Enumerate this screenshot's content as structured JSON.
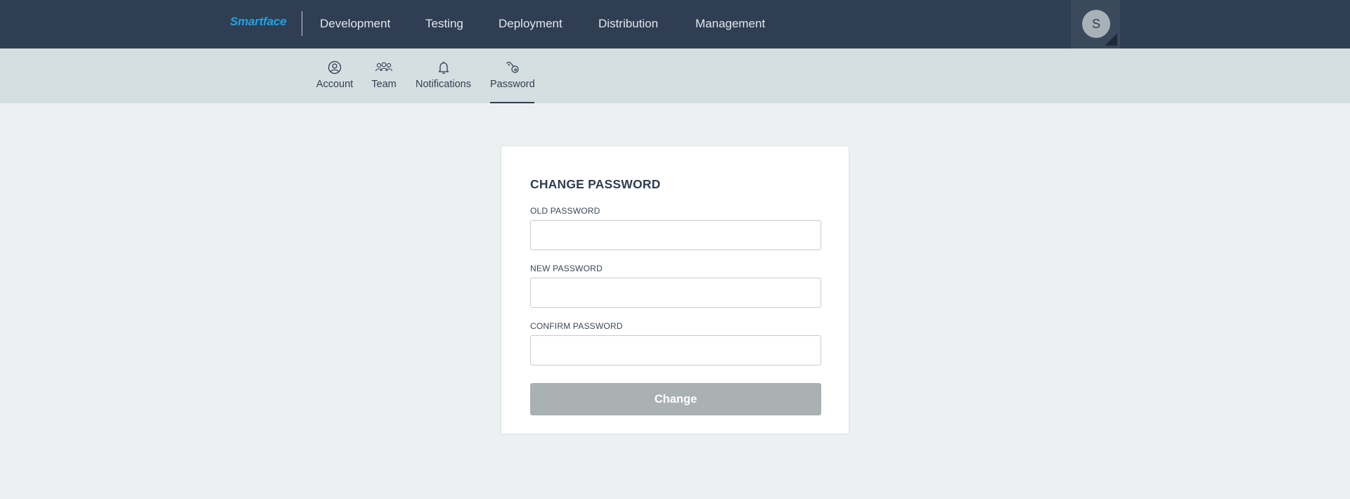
{
  "topbar": {
    "brand": "Smartface",
    "nav": [
      "Development",
      "Testing",
      "Deployment",
      "Distribution",
      "Management"
    ],
    "avatar_initial": "S"
  },
  "subnav": {
    "items": [
      {
        "label": "Account",
        "icon": "account-icon"
      },
      {
        "label": "Team",
        "icon": "team-icon"
      },
      {
        "label": "Notifications",
        "icon": "bell-icon"
      },
      {
        "label": "Password",
        "icon": "key-icon",
        "active": true
      }
    ]
  },
  "form": {
    "title": "CHANGE PASSWORD",
    "old_label": "OLD PASSWORD",
    "old_value": "",
    "new_label": "NEW PASSWORD",
    "new_value": "",
    "confirm_label": "CONFIRM PASSWORD",
    "confirm_value": "",
    "submit_label": "Change"
  },
  "colors": {
    "topbar": "#2f3e52",
    "brand": "#1fa3e7",
    "subbar": "#d5dee0",
    "background": "#ecf0f1",
    "button_disabled": "#aab1b3"
  }
}
